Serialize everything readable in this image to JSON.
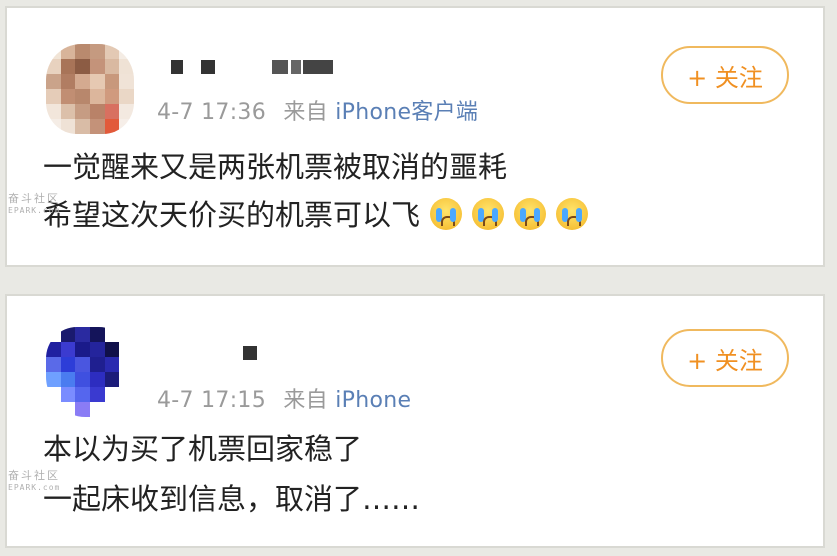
{
  "posts": [
    {
      "timestamp": "4-7 17:36",
      "source_prefix": "来自",
      "source": "iPhone客户端",
      "follow_label": "+ 关注",
      "lines": [
        "一觉醒来又是两张机票被取消的噩耗",
        "希望这次天价买的机票可以飞"
      ],
      "emoji": [
        "crying-face-icon",
        "crying-face-icon",
        "crying-face-icon",
        "crying-face-icon"
      ]
    },
    {
      "timestamp": "4-7 17:15",
      "source_prefix": "来自",
      "source": "iPhone",
      "follow_label": "+ 关注",
      "lines": [
        "本以为买了机票回家稳了",
        "一起床收到信息，取消了……"
      ]
    }
  ],
  "watermark": {
    "cn": "奋斗社区",
    "en": "EPARK.com"
  },
  "colors": {
    "accent": "#f09022",
    "link": "#5a7fb5",
    "meta": "#9a9a9a"
  }
}
